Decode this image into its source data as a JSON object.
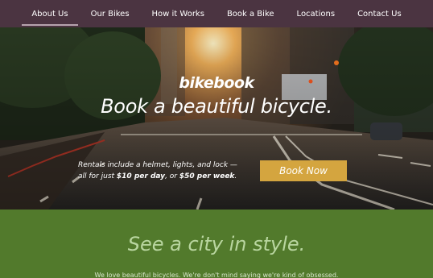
{
  "nav": {
    "items": [
      {
        "label": "About Us"
      },
      {
        "label": "Our Bikes"
      },
      {
        "label": "How it Works"
      },
      {
        "label": "Book a Bike"
      },
      {
        "label": "Locations"
      },
      {
        "label": "Contact Us"
      }
    ],
    "active_index": 0
  },
  "hero": {
    "logo": "bikebook",
    "tagline": "Book a beautiful bicycle.",
    "rental_line1": "Rentals include a helmet, lights, and lock —",
    "rental_prefix": "all for just ",
    "price_day": "$10 per day",
    "rental_middle": ", or ",
    "price_week": "$50 per week",
    "rental_suffix": ".",
    "book_button": "Book Now"
  },
  "section": {
    "title": "See a city in style.",
    "text": "We love beautiful bicycles. We're don't mind saying we're kind of obsessed."
  },
  "colors": {
    "nav_bg": "#4b3441",
    "accent": "#d4a53f",
    "green": "#527a2c"
  }
}
